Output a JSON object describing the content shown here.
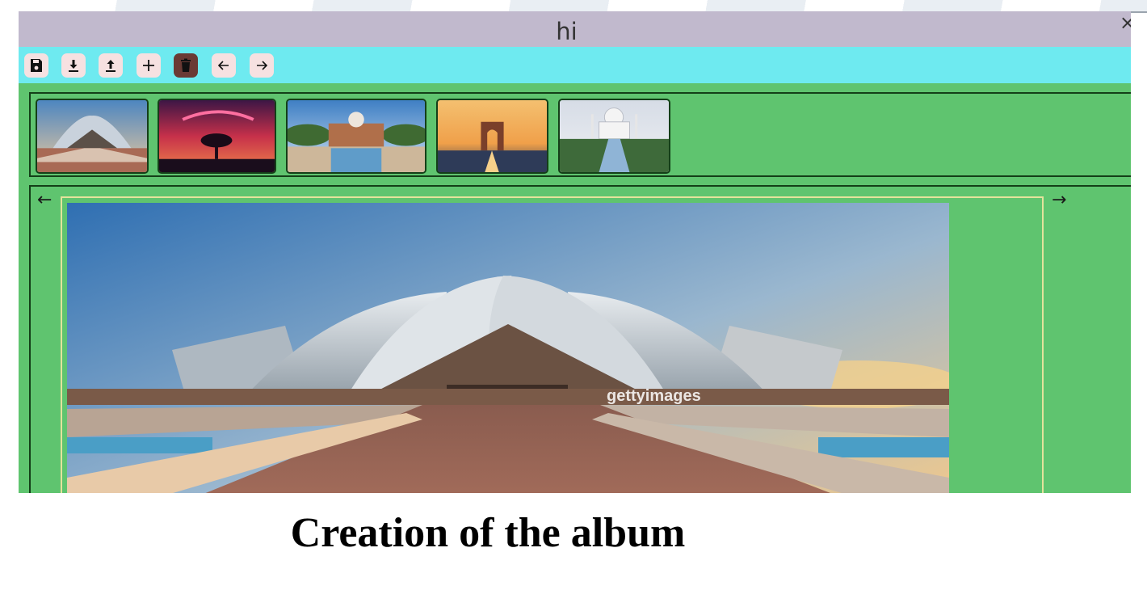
{
  "window": {
    "title": "hi",
    "close_symbol": "×"
  },
  "toolbar": {
    "buttons": [
      {
        "name": "save-icon"
      },
      {
        "name": "download-icon"
      },
      {
        "name": "upload-icon"
      },
      {
        "name": "add-icon"
      },
      {
        "name": "delete-icon"
      },
      {
        "name": "arrow-left-icon"
      },
      {
        "name": "arrow-right-icon"
      }
    ]
  },
  "thumbnails": [
    {
      "subject": "lotus-temple"
    },
    {
      "subject": "tree-sunset"
    },
    {
      "subject": "humayun-tomb"
    },
    {
      "subject": "india-gate"
    },
    {
      "subject": "taj-mahal"
    }
  ],
  "viewer": {
    "prev_symbol": "←",
    "next_symbol": "→",
    "watermark": "gettyimages"
  },
  "caption": "Creation of the album",
  "colors": {
    "title_bar": "#c1b9cd",
    "toolbar": "#6eeaf0",
    "content": "#5fc46f",
    "border": "#143f18",
    "frame": "#e4e29c",
    "delete_button": "#6a3a34"
  }
}
